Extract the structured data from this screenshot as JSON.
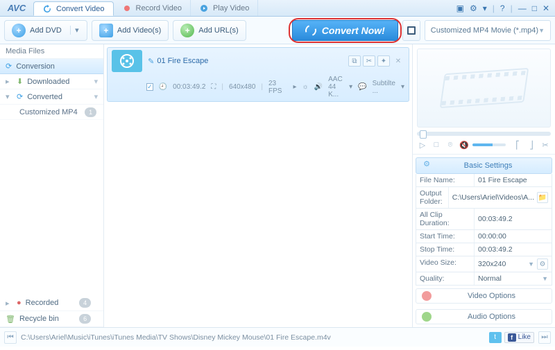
{
  "app": {
    "logo": "AVC"
  },
  "tabs": [
    {
      "label": "Convert Video",
      "active": true
    },
    {
      "label": "Record Video",
      "active": false
    },
    {
      "label": "Play Video",
      "active": false
    }
  ],
  "toolbar": {
    "add_dvd": "Add DVD",
    "add_videos": "Add Video(s)",
    "add_urls": "Add URL(s)",
    "convert": "Convert Now!",
    "profile": "Customized MP4 Movie (*.mp4)"
  },
  "sidebar": {
    "header": "Media Files",
    "conversion": "Conversion",
    "downloaded": "Downloaded",
    "converted": "Converted",
    "converted_child": "Customized MP4",
    "converted_badge": "1",
    "recorded": "Recorded",
    "recorded_badge": "4",
    "recycle": "Recycle bin",
    "recycle_badge": "6"
  },
  "media": {
    "title": "01 Fire Escape",
    "duration": "00:03:49.2",
    "resolution": "640x480",
    "fps": "23 FPS",
    "audio": "AAC 44 K...",
    "subtitle": "Subtilte ..."
  },
  "settings": {
    "header": "Basic Settings",
    "file_name_k": "File Name:",
    "file_name_v": "01 Fire Escape",
    "out_folder_k": "Output Folder:",
    "out_folder_v": "C:\\Users\\Ariel\\Videos\\A...",
    "clip_dur_k": "All Clip Duration:",
    "clip_dur_v": "00:03:49.2",
    "start_k": "Start Time:",
    "start_v": "00:00:00",
    "stop_k": "Stop Time:",
    "stop_v": "00:03:49.2",
    "vsize_k": "Video Size:",
    "vsize_v": "320x240",
    "quality_k": "Quality:",
    "quality_v": "Normal",
    "video_opts": "Video Options",
    "audio_opts": "Audio Options"
  },
  "status": {
    "path": "C:\\Users\\Ariel\\Music\\iTunes\\iTunes Media\\TV Shows\\Disney Mickey Mouse\\01 Fire Escape.m4v",
    "like": "Like"
  }
}
